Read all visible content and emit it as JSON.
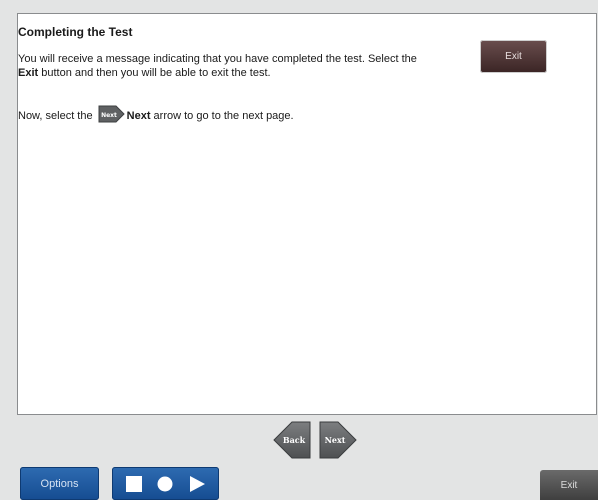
{
  "content": {
    "title": "Completing the Test",
    "para1_line1": "You will receive a message indicating that you have completed the test. Select the",
    "para1_bold": "Exit",
    "para1_line2_rest": " button and then you will be able to exit the test.",
    "para2_prefix": "Now, select the",
    "para2_bold": "Next",
    "para2_rest": " arrow to go to the next page.",
    "inline_exit_label": "Exit",
    "inline_next_label": "Next"
  },
  "nav": {
    "back_label": "Back",
    "next_label": "Next"
  },
  "bottom": {
    "options_label": "Options",
    "exit_label": "Exit",
    "media": [
      "stop-icon",
      "record-icon",
      "play-icon"
    ]
  },
  "colors": {
    "background": "#e3e4e4",
    "panel": "#ffffff",
    "blue_button": "#1f5ca3",
    "exit_dark": "#4a3030",
    "nav_gray": "#6b6d6f"
  }
}
